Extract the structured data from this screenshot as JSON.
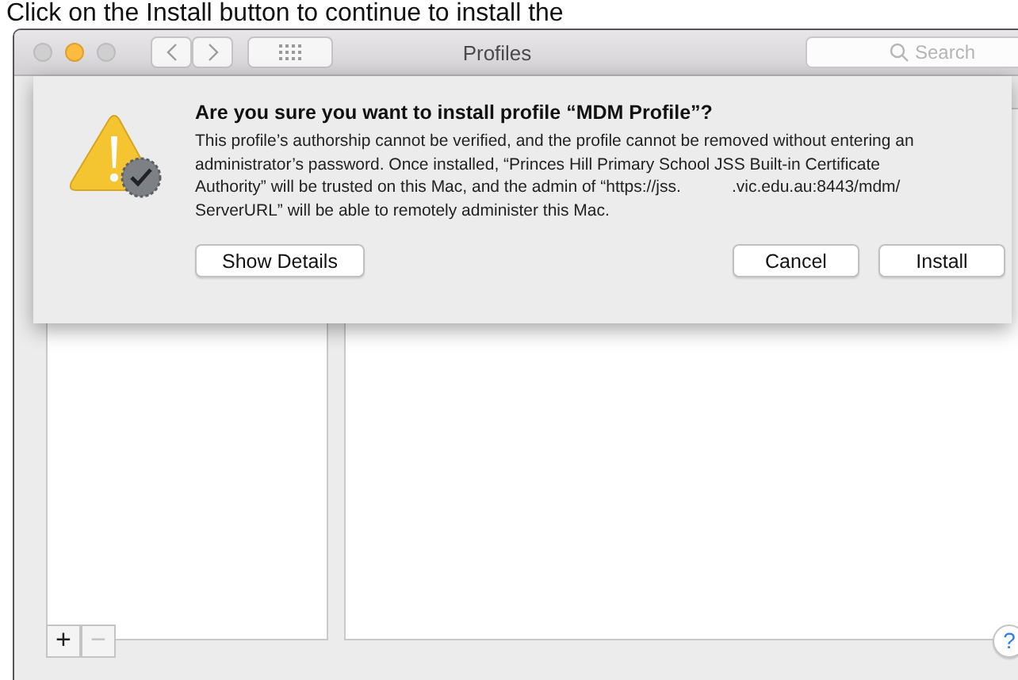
{
  "caption": "Click on the Install button to continue to install the",
  "window": {
    "title": "Profiles",
    "search": {
      "placeholder": "Search"
    },
    "traffic_lights": [
      {
        "kind": "close",
        "active": false
      },
      {
        "kind": "minimize",
        "active": true
      },
      {
        "kind": "zoom",
        "active": false
      }
    ]
  },
  "dialog": {
    "heading": "Are you sure you want to install profile “MDM Profile”?",
    "message": "This profile’s authorship cannot be verified, and the profile cannot be removed without entering an\nadministrator’s password. Once installed, “Princes Hill Primary School JSS Built-in Certificate\nAuthority” will be trusted on this Mac, and the admin of “https://jss.           .vic.edu.au:8443/mdm/\nServerURL” will be able to remotely administer this Mac.",
    "buttons": [
      {
        "label": "Show Details",
        "kind": "left"
      },
      {
        "label": "Cancel",
        "kind": "right"
      },
      {
        "label": "Install",
        "kind": "right"
      }
    ]
  },
  "list_buttons": [
    {
      "label": "+",
      "disabled": false
    },
    {
      "label": "−",
      "disabled": true
    }
  ],
  "help": {
    "label": "?"
  }
}
